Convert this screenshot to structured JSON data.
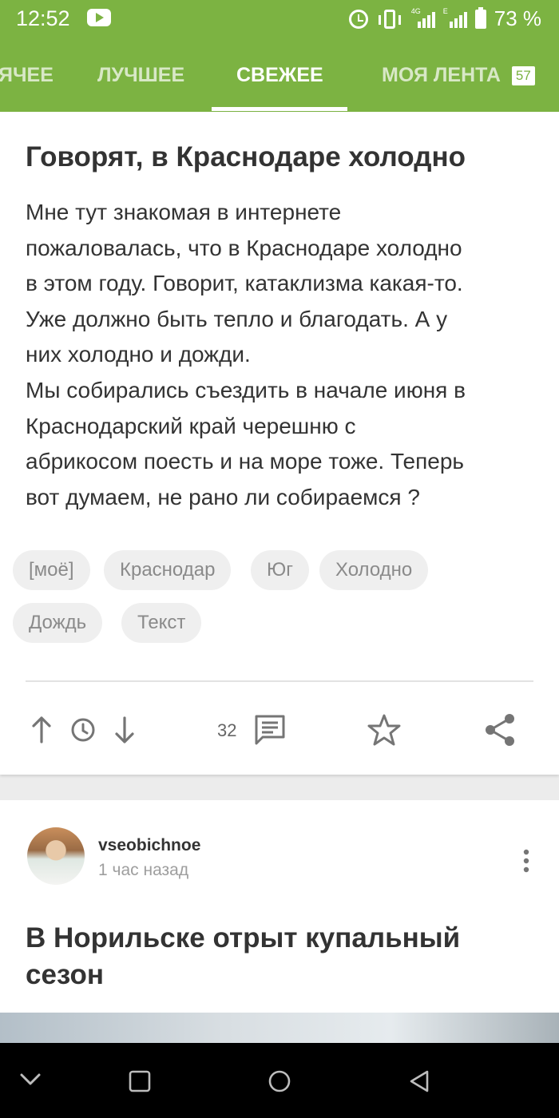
{
  "status_bar": {
    "time": "12:52",
    "network": "4G",
    "network2": "E",
    "battery": "73 %"
  },
  "tabs": {
    "items": [
      "ГОРЯЧЕЕ",
      "ЛУЧШЕЕ",
      "СВЕЖЕЕ",
      "МОЯ ЛЕНТА"
    ],
    "visible": [
      "ЯЧЕЕ",
      "ЛУЧШЕЕ",
      "СВЕЖЕЕ",
      "МОЯ ЛЕНТА"
    ],
    "active": "СВЕЖЕЕ",
    "feed_badge": "57"
  },
  "post1": {
    "title": "Говорят, в Краснодаре холодно",
    "body_lines": [
      "Мне тут знакомая в интернете",
      "пожаловалась, что в Краснодаре холодно",
      "в этом году. Говорит, катаклизма какая-то.",
      "Уже должно быть тепло и благодать. А у",
      "них холодно и дожди.",
      "Мы собирались съездить в начале июня в",
      "Краснодарский край черешню с",
      "абрикосом поесть и на море тоже. Теперь",
      "вот думаем, не рано ли собираемся ?"
    ],
    "tags": [
      "[моё]",
      "Краснодар",
      "Юг",
      "Холодно",
      "Дождь",
      "Текст"
    ],
    "comments_count": "32"
  },
  "post2": {
    "author": "vseobichnoe",
    "time": "1 час назад",
    "title": "В Норильске отрыт купальный сезон"
  },
  "colors": {
    "accent": "#7cb342",
    "text": "#333333",
    "muted": "#9e9e9e",
    "icon": "#757575"
  },
  "icons": {
    "status": [
      "youtube-icon",
      "alarm-icon",
      "vibrate-icon",
      "signal-icon",
      "battery-icon"
    ],
    "actions": [
      "upvote-icon",
      "clock-icon",
      "downvote-icon",
      "comment-icon",
      "star-icon",
      "share-icon"
    ],
    "nav": [
      "chevron-down-icon",
      "recents-icon",
      "home-icon",
      "back-icon"
    ]
  }
}
